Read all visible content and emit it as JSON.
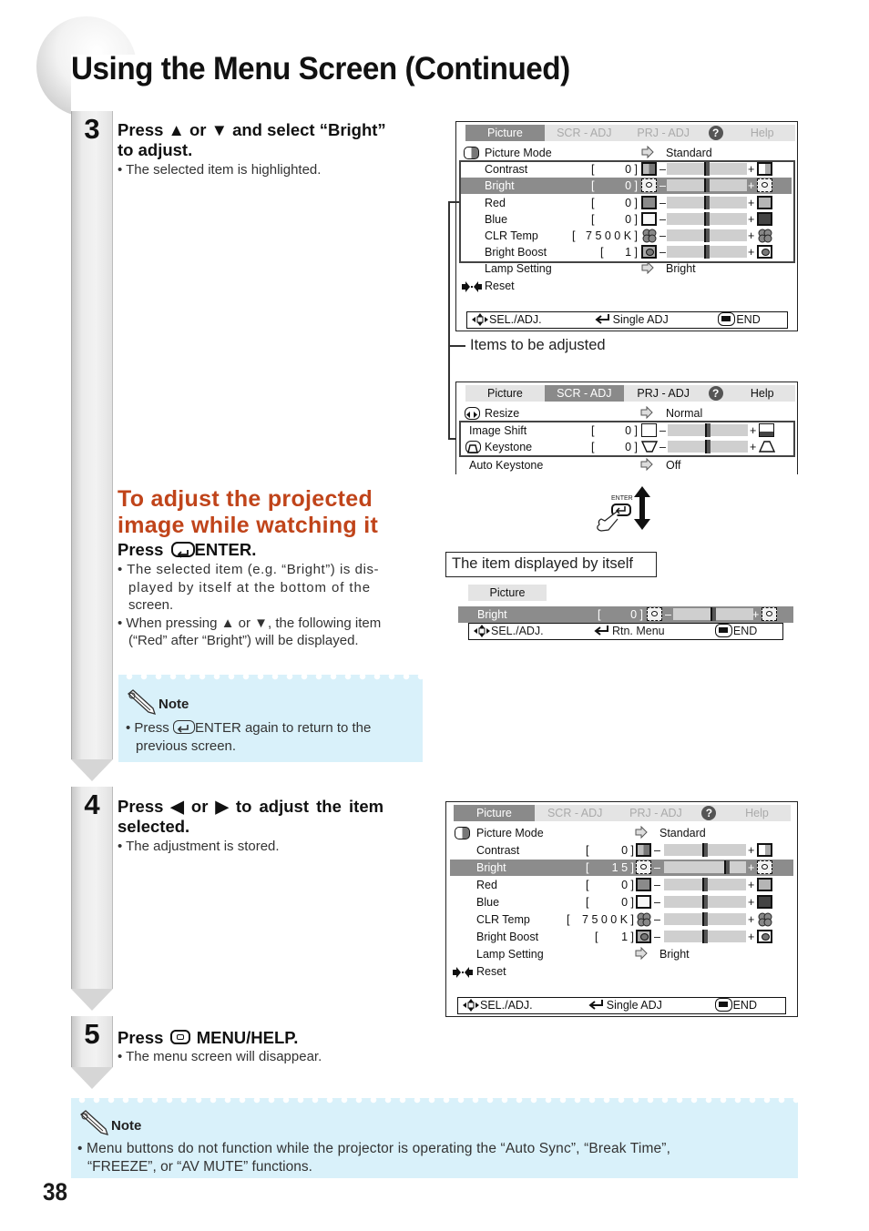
{
  "page": {
    "title": "Using the Menu Screen (Continued)",
    "page_number": "38"
  },
  "steps": [
    {
      "number": "3",
      "heading_line1": "Press ▲ or ▼ and select “Bright”",
      "heading_line2": "to adjust.",
      "bullets": [
        "• The selected item is highlighted."
      ]
    },
    {
      "number": "4",
      "heading_line1": "Press ◀ or ▶ to adjust the item",
      "heading_line2": "selected.",
      "bullets": [
        "• The adjustment is stored."
      ]
    },
    {
      "number": "5",
      "heading_prefix": "Press",
      "heading_suffix": "MENU/HELP.",
      "bullets": [
        "• The menu screen will disappear."
      ]
    }
  ],
  "watching_section": {
    "heading_line1": "To adjust the projected",
    "heading_line2": "image while watching it",
    "press_prefix": "Press",
    "press_suffix": "ENTER.",
    "bullets": [
      "• The selected item (e.g. “Bright”) is dis-",
      "played by itself at the bottom of the",
      "screen.",
      "• When pressing ▲ or ▼, the following item",
      "(“Red” after “Bright”) will be displayed."
    ],
    "color": "#c0441a"
  },
  "note_small": {
    "title": "Note",
    "line1_prefix": "• Press",
    "line1_suffix": "ENTER again to return to the",
    "line2": "previous screen."
  },
  "note_bottom": {
    "title": "Note",
    "line1": "• Menu buttons do not function while the projector is operating the “Auto Sync”, “Break Time”,",
    "line2": "“FREEZE”, or “AV MUTE” functions."
  },
  "callouts": {
    "items_to_adjust": "Items to be adjusted",
    "displayed_by_itself": "The item displayed by itself",
    "enter_key_label": "ENTER"
  },
  "osd_common": {
    "tabs": [
      "Picture",
      "SCR - ADJ",
      "PRJ - ADJ",
      "Help"
    ],
    "footer": {
      "sel": "SEL./ADJ.",
      "single": "Single ADJ",
      "end": "END",
      "rtn": "Rtn. Menu"
    }
  },
  "osd_picture_1": {
    "active_tab": "Picture",
    "picture_mode": {
      "label": "Picture Mode",
      "value": "Standard"
    },
    "items": [
      {
        "label": "Contrast",
        "value": "0",
        "slider": 0.5,
        "highlighted": false
      },
      {
        "label": "Bright",
        "value": "0",
        "slider": 0.5,
        "highlighted": true
      },
      {
        "label": "Red",
        "value": "0",
        "slider": 0.5,
        "highlighted": false
      },
      {
        "label": "Blue",
        "value": "0",
        "slider": 0.5,
        "highlighted": false
      },
      {
        "label": "CLR Temp",
        "value": "7 5 0 0 K",
        "slider": 0.5,
        "highlighted": false
      },
      {
        "label": "Bright Boost",
        "value": "1",
        "slider": 0.5,
        "highlighted": false
      }
    ],
    "lamp_setting": {
      "label": "Lamp Setting",
      "value": "Bright"
    },
    "reset": "Reset"
  },
  "osd_scr_adj": {
    "active_tab": "SCR - ADJ",
    "resize": {
      "label": "Resize",
      "value": "Normal"
    },
    "items": [
      {
        "label": "Image Shift",
        "value": "0",
        "slider": 0.5
      },
      {
        "label": "Keystone",
        "value": "0",
        "slider": 0.5
      }
    ],
    "auto_keystone": {
      "label": "Auto Keystone",
      "value": "Off"
    }
  },
  "osd_single": {
    "tab": "Picture",
    "item": {
      "label": "Bright",
      "value": "0",
      "slider": 0.5
    }
  },
  "osd_picture_2": {
    "active_tab": "Picture",
    "picture_mode": {
      "label": "Picture Mode",
      "value": "Standard"
    },
    "items": [
      {
        "label": "Contrast",
        "value": "0",
        "slider": 0.5,
        "highlighted": false
      },
      {
        "label": "Bright",
        "value": "1 5",
        "slider": 0.77,
        "highlighted": true
      },
      {
        "label": "Red",
        "value": "0",
        "slider": 0.5,
        "highlighted": false
      },
      {
        "label": "Blue",
        "value": "0",
        "slider": 0.5,
        "highlighted": false
      },
      {
        "label": "CLR Temp",
        "value": "7 5 0 0 K",
        "slider": 0.5,
        "highlighted": false
      },
      {
        "label": "Bright Boost",
        "value": "1",
        "slider": 0.5,
        "highlighted": false
      }
    ],
    "lamp_setting": {
      "label": "Lamp Setting",
      "value": "Bright"
    },
    "reset": "Reset"
  }
}
